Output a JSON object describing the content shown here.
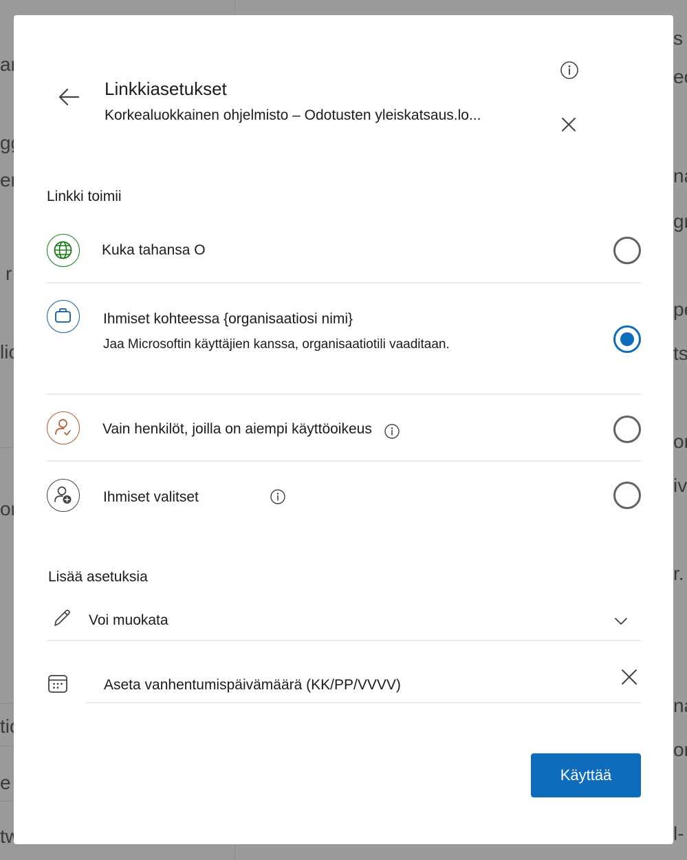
{
  "dialog": {
    "title": "Linkkiasetukset",
    "subtitle": "Korkealuokkainen ohjelmisto – Odotusten yleiskatsaus.lo..."
  },
  "link_works_section": {
    "heading": "Linkki toimii",
    "options": [
      {
        "icon": "globe-icon",
        "label": "Kuka tahansa O",
        "selected": false
      },
      {
        "icon": "briefcase-icon",
        "label": "Ihmiset kohteessa {organisaatiosi nimi}",
        "description": "Jaa Microsoftin käyttäjien kanssa, organisaatiotili vaaditaan.",
        "selected": true
      },
      {
        "icon": "person-check-icon",
        "label": "Vain henkilöt, joilla on aiempi käyttöoikeus",
        "selected": false
      },
      {
        "icon": "person-add-icon",
        "label": "Ihmiset valitset",
        "selected": false
      }
    ]
  },
  "more_settings": {
    "heading": "Lisää asetuksia",
    "permission_value": "Voi muokata",
    "expiration_placeholder": "Aseta vanhentumispäivämäärä (KK/PP/VVVV)"
  },
  "apply_label": "Käyttää",
  "background_fragments": [
    "ar",
    "gg",
    "er",
    "r",
    "lic",
    "or",
    "tic",
    "e c",
    "tw",
    "s",
    "ect",
    "na",
    "gr",
    "pe",
    "ts",
    "or",
    "iv",
    "r.",
    "na",
    "or",
    "l-"
  ],
  "colors": {
    "accent": "#0f6cbd",
    "globe_green": "#107c10",
    "briefcase_blue": "#0f5a9c",
    "person_brown": "#b05a2a",
    "person_gray": "#424242"
  }
}
